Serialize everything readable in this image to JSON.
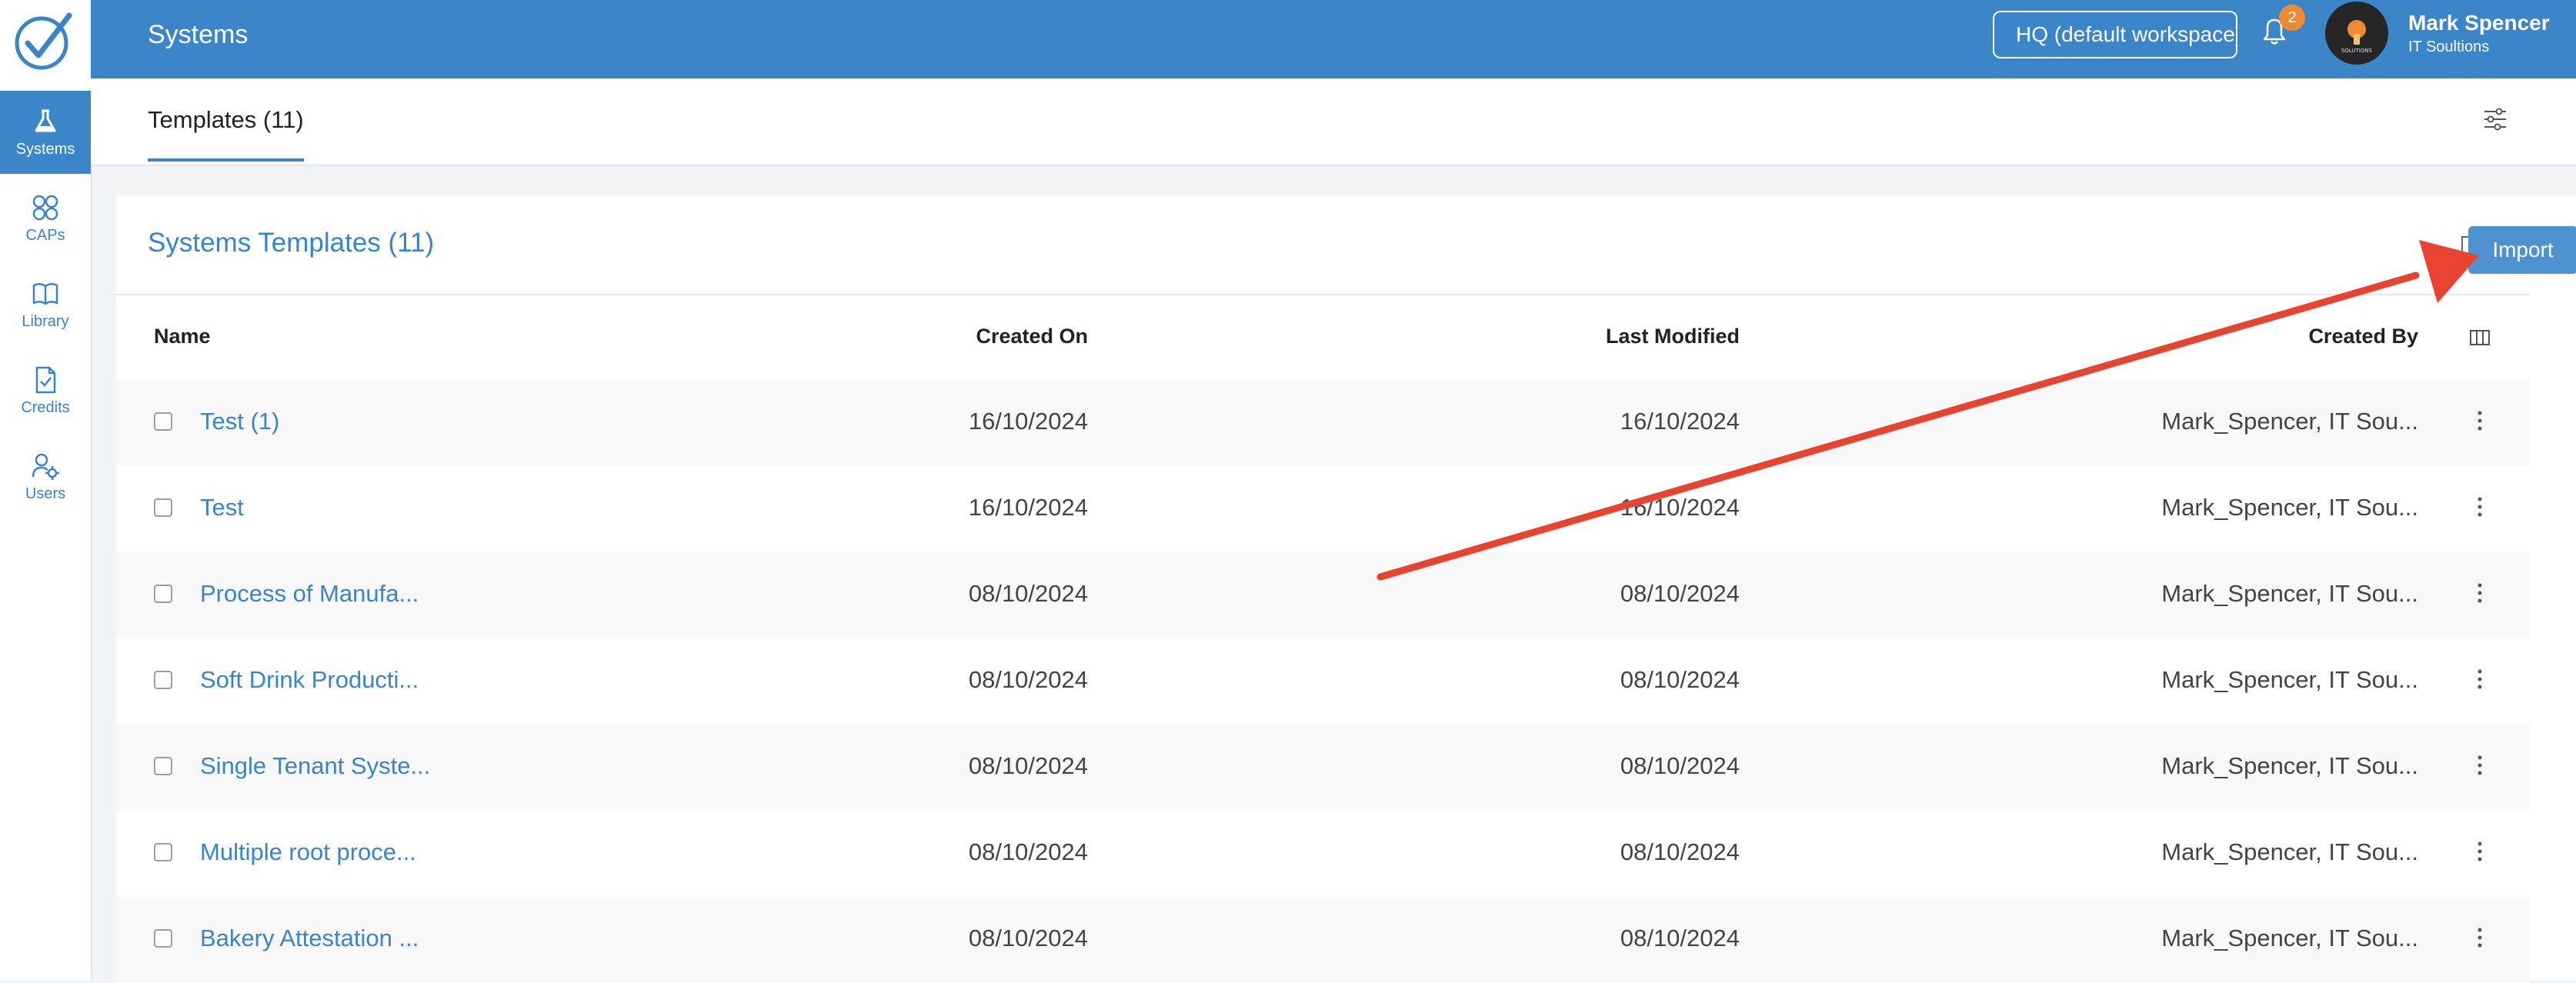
{
  "sidebar": {
    "logo_icon": "checkmark-circle-logo",
    "items": [
      {
        "label": "Systems",
        "icon": "flask-icon",
        "active": true
      },
      {
        "label": "CAPs",
        "icon": "grid-icon"
      },
      {
        "label": "Library",
        "icon": "book-icon"
      },
      {
        "label": "Credits",
        "icon": "document-check-icon"
      },
      {
        "label": "Users",
        "icon": "users-gear-icon"
      }
    ]
  },
  "header": {
    "title": "Systems",
    "workspace_select": "HQ (default workspace)",
    "notification_count": "2",
    "user_name": "Mark Spencer",
    "user_org": "IT Soultions",
    "avatar_text": "SOLUTIONS",
    "brand_color": "#3b86c8"
  },
  "tabs": [
    {
      "label": "Templates (11)",
      "active": true
    }
  ],
  "card": {
    "title": "Systems Templates (11)",
    "tooltip": "Import",
    "columns": [
      "Name",
      "Created On",
      "Last Modified",
      "Created By"
    ],
    "rows": [
      {
        "name": "Test (1)",
        "created": "16/10/2024",
        "modified": "16/10/2024",
        "by": "Mark_Spencer, IT Sou..."
      },
      {
        "name": "Test",
        "created": "16/10/2024",
        "modified": "16/10/2024",
        "by": "Mark_Spencer, IT Sou..."
      },
      {
        "name": "Process of Manufa...",
        "created": "08/10/2024",
        "modified": "08/10/2024",
        "by": "Mark_Spencer, IT Sou..."
      },
      {
        "name": "Soft Drink Producti...",
        "created": "08/10/2024",
        "modified": "08/10/2024",
        "by": "Mark_Spencer, IT Sou..."
      },
      {
        "name": "Single Tenant Syste...",
        "created": "08/10/2024",
        "modified": "08/10/2024",
        "by": "Mark_Spencer, IT Sou..."
      },
      {
        "name": "Multiple root proce...",
        "created": "08/10/2024",
        "modified": "08/10/2024",
        "by": "Mark_Spencer, IT Sou..."
      },
      {
        "name": "Bakery Attestation ...",
        "created": "08/10/2024",
        "modified": "08/10/2024",
        "by": "Mark_Spencer, IT Sou..."
      }
    ]
  },
  "annotation": {
    "type": "arrow",
    "color": "#e8432e",
    "points_to": "import-icon"
  }
}
